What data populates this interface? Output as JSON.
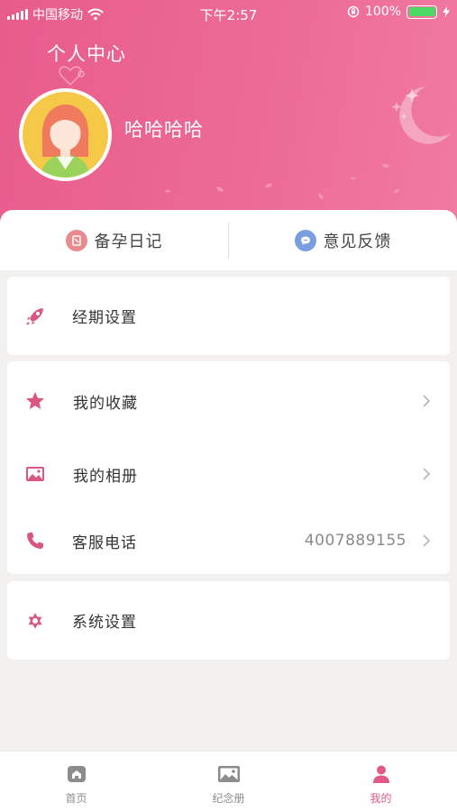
{
  "status_bar": {
    "carrier": "中国移动",
    "time": "下午2:57",
    "battery_percent": "100%"
  },
  "header": {
    "title": "个人中心",
    "username": "哈哈哈哈"
  },
  "quick_actions": [
    {
      "label": "备孕日记",
      "icon": "diary-icon"
    },
    {
      "label": "意见反馈",
      "icon": "feedback-chat-icon"
    }
  ],
  "menu": {
    "period_settings": "经期设置",
    "favorites": "我的收藏",
    "album": "我的相册",
    "customer_service": "客服电话",
    "customer_service_phone": "4007889155",
    "system_settings": "系统设置"
  },
  "tabbar": [
    {
      "label": "首页",
      "icon": "home-icon",
      "active": false
    },
    {
      "label": "纪念册",
      "icon": "album-icon",
      "active": false
    },
    {
      "label": "我的",
      "icon": "person-icon",
      "active": true
    }
  ],
  "colors": {
    "brand_pink": "#e85c8c",
    "icon_pink": "#d9587f",
    "active_tab": "#e05a86",
    "battery_green": "#4cd964"
  }
}
